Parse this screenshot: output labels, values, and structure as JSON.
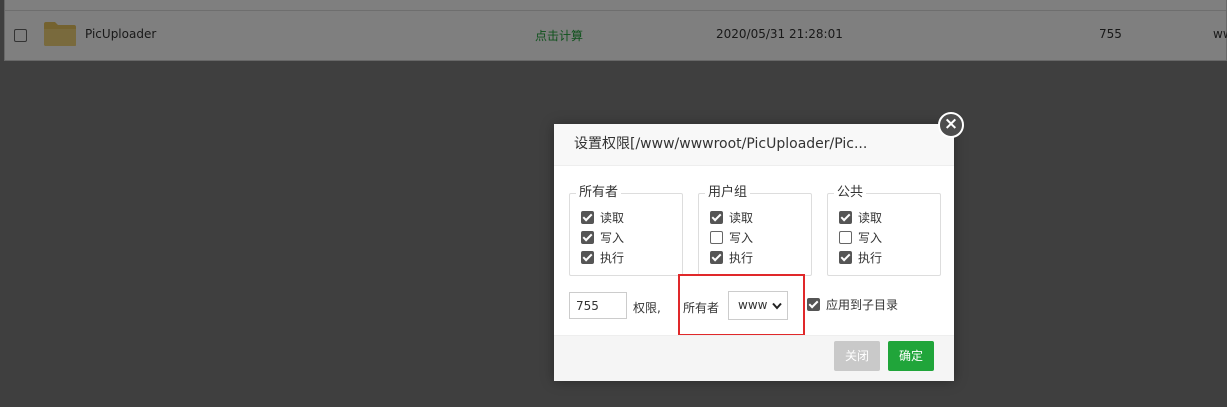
{
  "file_row": {
    "name": "PicUploader",
    "size_action": "点击计算",
    "modified": "2020/05/31 21:28:01",
    "permission": "755",
    "owner": "ww"
  },
  "dialog": {
    "title": "设置权限[/www/wwwroot/PicUploader/Pic...",
    "close_icon": "×",
    "groups": [
      {
        "legend": "所有者",
        "read": "读取",
        "write": "写入",
        "exec": "执行",
        "read_checked": true,
        "write_checked": true,
        "exec_checked": true
      },
      {
        "legend": "用户组",
        "read": "读取",
        "write": "写入",
        "exec": "执行",
        "read_checked": true,
        "write_checked": false,
        "exec_checked": true
      },
      {
        "legend": "公共",
        "read": "读取",
        "write": "写入",
        "exec": "执行",
        "read_checked": true,
        "write_checked": false,
        "exec_checked": true
      }
    ],
    "permission_value": "755",
    "permission_label": "权限,",
    "owner_label": "所有者",
    "owner_selected": "www",
    "apply_subdir_label": "应用到子目录",
    "apply_subdir_checked": true,
    "buttons": {
      "close": "关闭",
      "confirm": "确定"
    }
  },
  "colors": {
    "accent_green": "#20a53a",
    "highlight_red": "#e0282a"
  }
}
